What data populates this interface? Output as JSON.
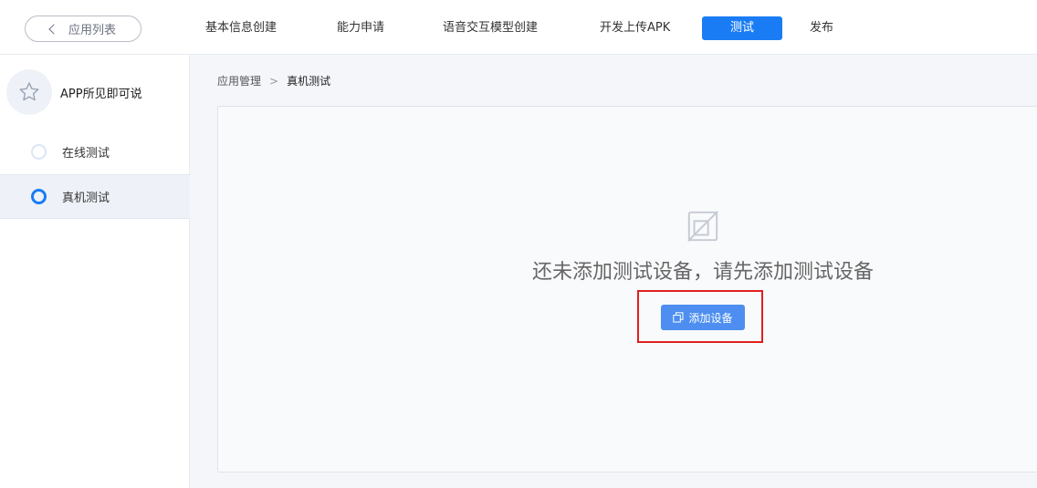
{
  "header": {
    "back_label": "应用列表",
    "tabs": [
      {
        "label": "基本信息创建"
      },
      {
        "label": "能力申请"
      },
      {
        "label": "语音交互模型创建"
      },
      {
        "label": "开发上传APK"
      },
      {
        "label": "测试",
        "active": true
      },
      {
        "label": "发布"
      }
    ]
  },
  "sidebar": {
    "app_name": "APP所见即可说",
    "app_icon": "star-icon",
    "items": [
      {
        "label": "在线测试"
      },
      {
        "label": "真机测试",
        "active": true
      }
    ]
  },
  "breadcrumb": {
    "parent": "应用管理",
    "current": "真机测试"
  },
  "empty_state": {
    "icon": "no-device-icon",
    "message": "还未添加测试设备，请先添加测试设备",
    "button_label": "添加设备"
  },
  "colors": {
    "accent": "#1a7cf5",
    "button": "#4d8ef0",
    "highlight": "#e0201f"
  }
}
